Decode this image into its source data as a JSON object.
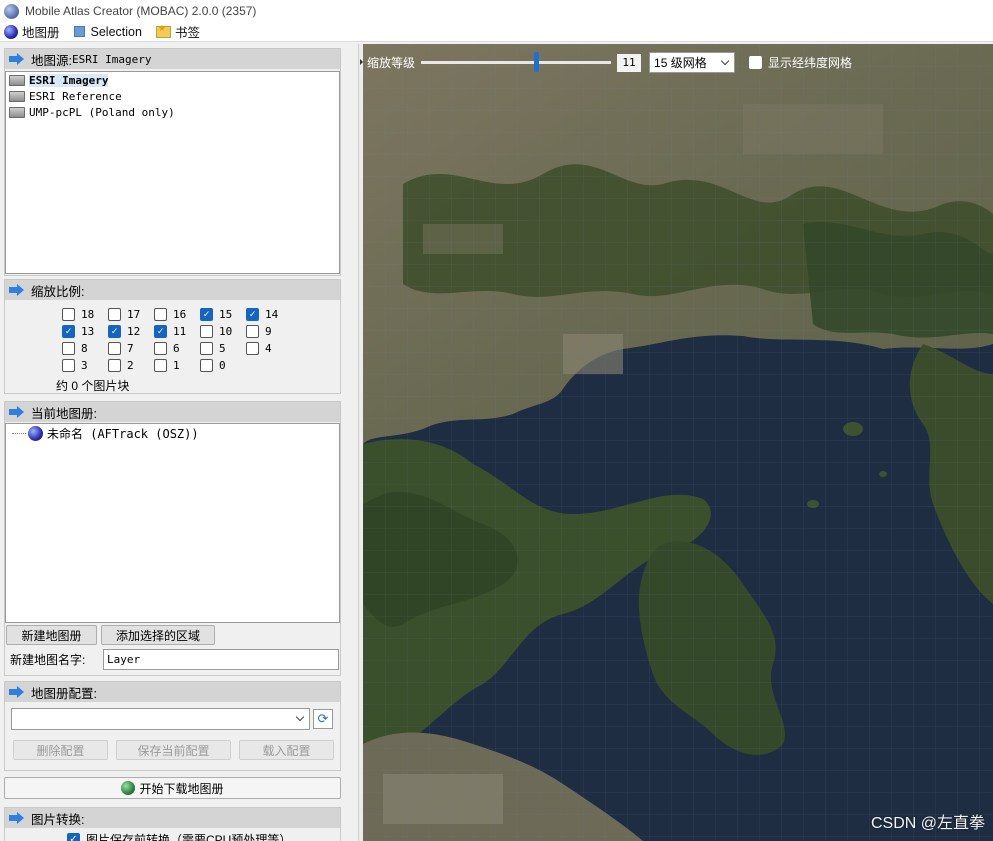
{
  "window": {
    "title": "Mobile Atlas Creator (MOBAC) 2.0.0 (2357)"
  },
  "menu": [
    {
      "label": "地图册",
      "icon": "globe-icon"
    },
    {
      "label": "Selection",
      "icon": "selection-icon"
    },
    {
      "label": "书签",
      "icon": "bookmark-folder-icon"
    }
  ],
  "map_source": {
    "header_prefix": "地图源:",
    "header_value": "ESRI Imagery",
    "items": [
      {
        "label": "ESRI Imagery",
        "selected": true
      },
      {
        "label": "ESRI Reference",
        "selected": false
      },
      {
        "label": "UMP-pcPL (Poland only)",
        "selected": false
      }
    ]
  },
  "zoom_levels": {
    "header": "缩放比例:",
    "levels": [
      {
        "label": "18",
        "checked": false
      },
      {
        "label": "17",
        "checked": false
      },
      {
        "label": "16",
        "checked": false
      },
      {
        "label": "15",
        "checked": true
      },
      {
        "label": "14",
        "checked": true
      },
      {
        "label": "13",
        "checked": true
      },
      {
        "label": "12",
        "checked": true
      },
      {
        "label": "11",
        "checked": true
      },
      {
        "label": "10",
        "checked": false
      },
      {
        "label": "9",
        "checked": false
      },
      {
        "label": "8",
        "checked": false
      },
      {
        "label": "7",
        "checked": false
      },
      {
        "label": "6",
        "checked": false
      },
      {
        "label": "5",
        "checked": false
      },
      {
        "label": "4",
        "checked": false
      },
      {
        "label": "3",
        "checked": false
      },
      {
        "label": "2",
        "checked": false
      },
      {
        "label": "1",
        "checked": false
      },
      {
        "label": "0",
        "checked": false
      }
    ],
    "tile_count": "约 0 个图片块"
  },
  "current_atlas": {
    "header": "当前地图册:",
    "tree_item": "未命名 (AFTrack (OSZ))",
    "new_atlas_button": "新建地图册",
    "add_selection_button": "添加选择的区域",
    "new_map_name_label": "新建地图名字:",
    "new_map_name_value": "Layer"
  },
  "atlas_profile": {
    "header": "地图册配置:",
    "selected_profile": "",
    "delete_button": "删除配置",
    "save_button": "保存当前配置",
    "load_button": "载入配置"
  },
  "download_button": "开始下载地图册",
  "tile_conversion": {
    "header": "图片转换:",
    "option_label": "图片保存前转换（需要CPU预处理等）"
  },
  "map_toolbar": {
    "zoom_label": "缩放等级",
    "zoom_value": "11",
    "zoom_fraction": 0.61,
    "grid_select": "15 级网格",
    "latlon_grid_label": "显示经纬度网格",
    "latlon_grid_checked": false
  },
  "watermark": "CSDN @左直拳",
  "colors": {
    "accent": "#1e6fd0",
    "section_header": "#d4d4d4",
    "sea": "#1d2a3d"
  }
}
